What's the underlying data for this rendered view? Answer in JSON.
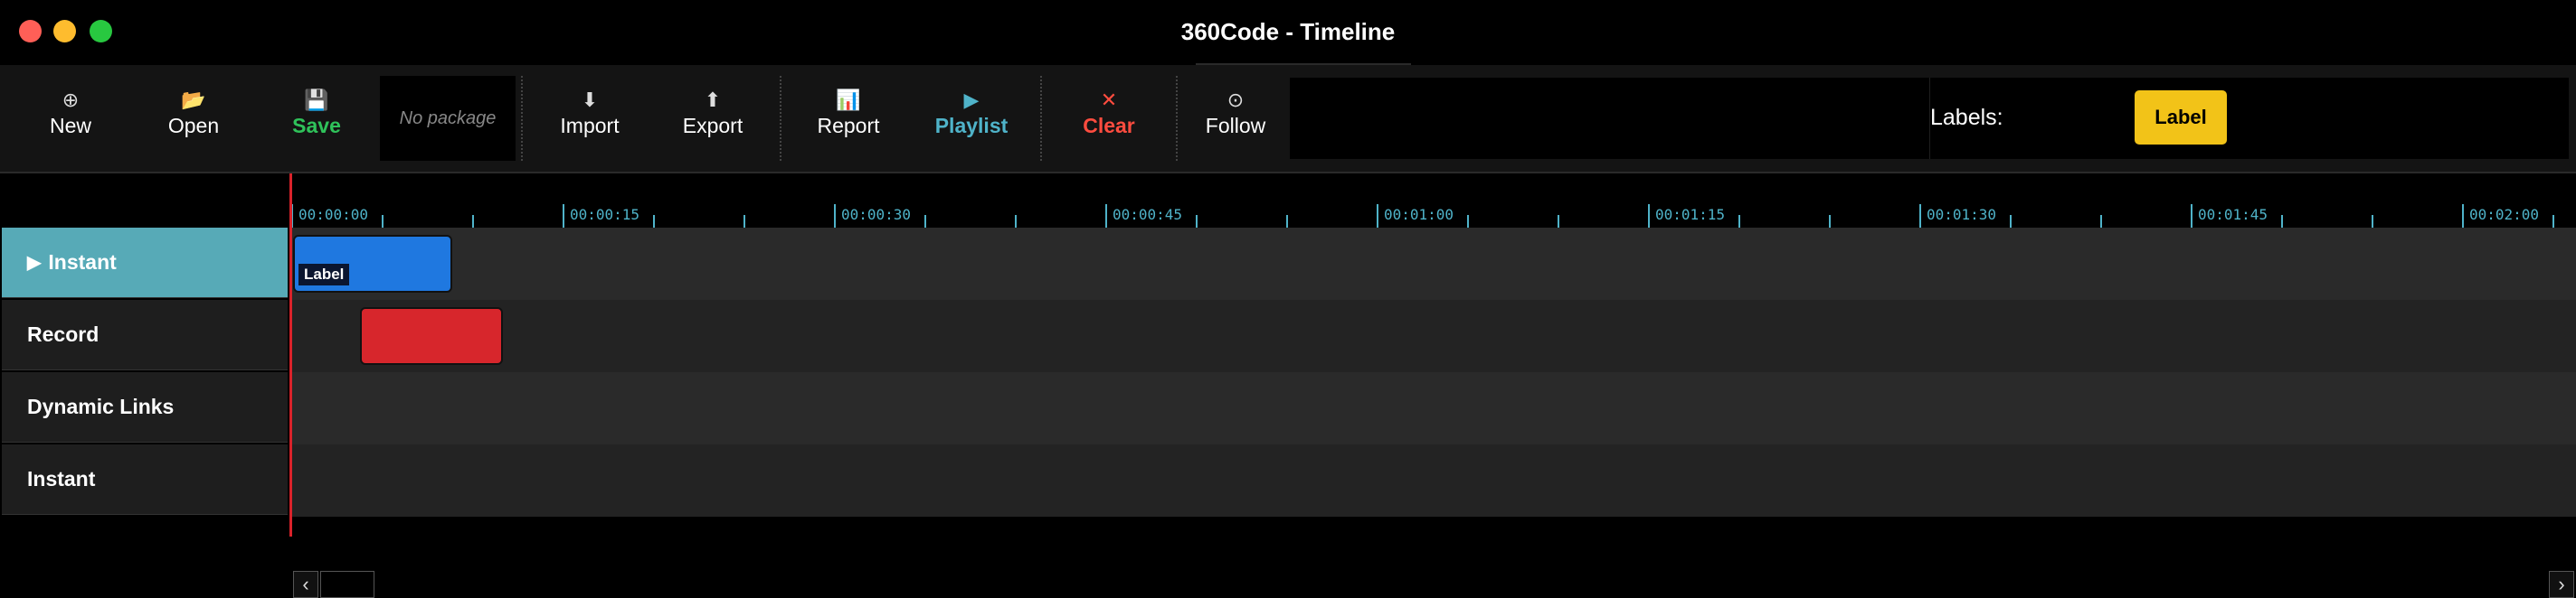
{
  "window": {
    "title": "360Code - Timeline"
  },
  "toolbar": {
    "new_label": "New",
    "new_icon": "plus-circle-icon",
    "open_label": "Open",
    "open_icon": "folder-icon",
    "save_label": "Save",
    "save_icon": "floppy-icon",
    "package_placeholder": "No package",
    "import_label": "Import",
    "import_icon": "arrow-down-icon",
    "export_label": "Export",
    "export_icon": "arrow-up-icon",
    "report_label": "Report",
    "report_icon": "bar-chart-icon",
    "playlist_label": "Playlist",
    "playlist_icon": "play-icon",
    "clear_label": "Clear",
    "clear_icon": "x-icon",
    "follow_label": "Follow",
    "follow_icon": "target-icon"
  },
  "labels": {
    "title": "Labels:",
    "chip": "Label",
    "chip_color": "#f2c318"
  },
  "tracks": [
    {
      "label": "Instant",
      "active": true
    },
    {
      "label": "Record",
      "active": false
    },
    {
      "label": "Dynamic Links",
      "active": false
    },
    {
      "label": "Instant",
      "active": false
    }
  ],
  "ruler": {
    "labels": [
      "00:00:00",
      "00:00:15",
      "00:00:30",
      "00:00:45",
      "00:01:00",
      "00:01:15",
      "00:01:30",
      "00:01:45",
      "00:02:00"
    ]
  },
  "clips": [
    {
      "track": 0,
      "color": "#1f78e0",
      "tag": "Label"
    },
    {
      "track": 1,
      "color": "#d7262c",
      "tag": ""
    }
  ],
  "colors": {
    "accent": "#4fb3c9",
    "save": "#2fc25a",
    "clear": "#ff4c3f",
    "playhead": "#d9222a"
  }
}
